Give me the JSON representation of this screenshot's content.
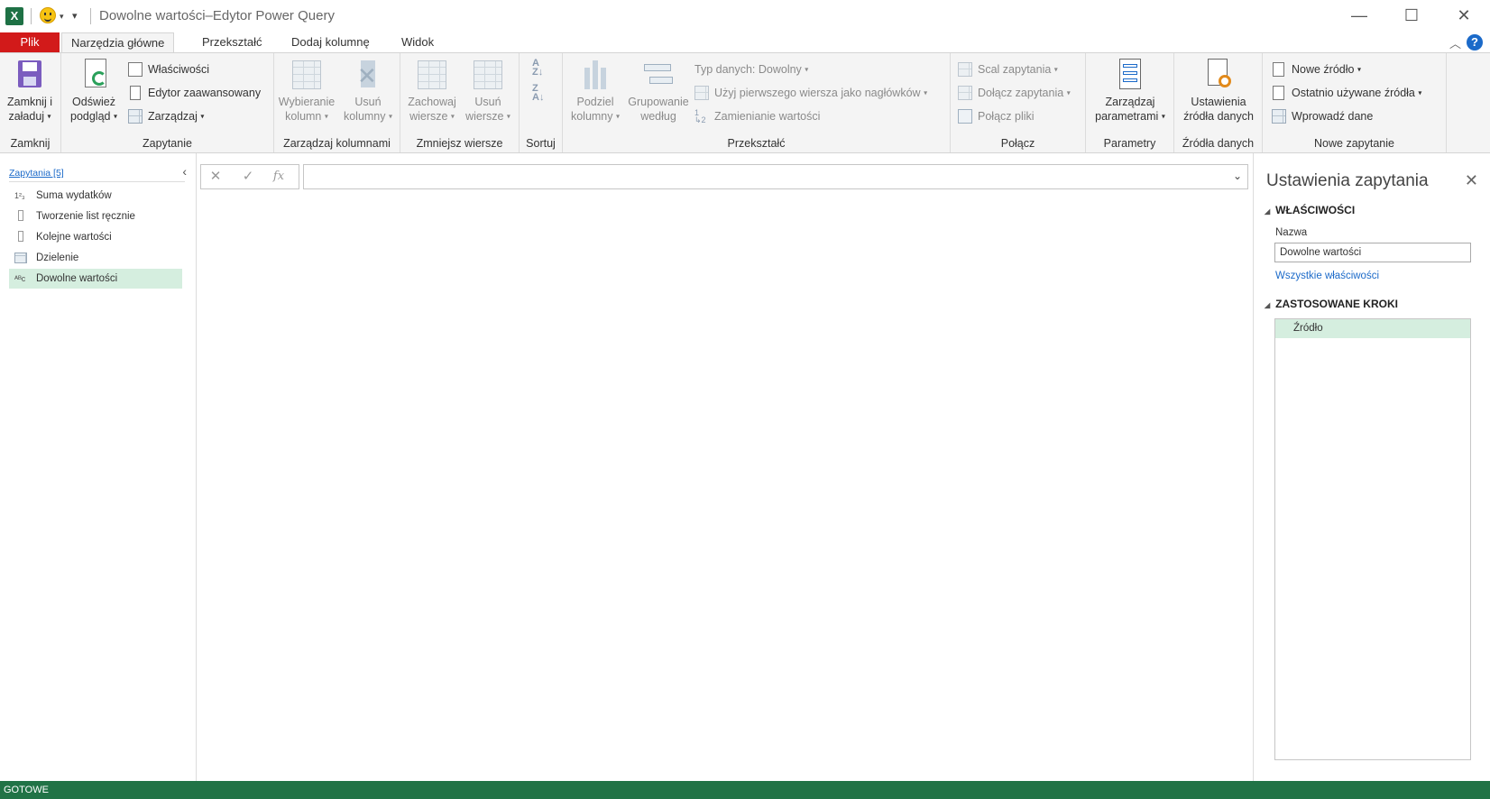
{
  "window": {
    "title": "Dowolne wartości–Edytor Power Query",
    "app_logo": "X"
  },
  "tabs": {
    "file": "Plik",
    "home": "Narzędzia główne",
    "transform": "Przekształć",
    "add_column": "Dodaj kolumnę",
    "view": "Widok",
    "help": "?"
  },
  "ribbon": {
    "close": {
      "group": "Zamknij",
      "btn_line1": "Zamknij i",
      "btn_line2": "załaduj"
    },
    "query": {
      "group": "Zapytanie",
      "refresh_line1": "Odśwież",
      "refresh_line2": "podgląd",
      "properties": "Właściwości",
      "advanced_editor": "Edytor zaawansowany",
      "manage": "Zarządzaj"
    },
    "manage_columns": {
      "group": "Zarządzaj kolumnami",
      "choose_line1": "Wybieranie",
      "choose_line2": "kolumn",
      "remove_line1": "Usuń",
      "remove_line2": "kolumny"
    },
    "reduce_rows": {
      "group": "Zmniejsz wiersze",
      "keep_line1": "Zachowaj",
      "keep_line2": "wiersze",
      "remove_line1": "Usuń",
      "remove_line2": "wiersze"
    },
    "sort": {
      "group": "Sortuj"
    },
    "transform": {
      "group": "Przekształć",
      "split_line1": "Podziel",
      "split_line2": "kolumny",
      "group_line1": "Grupowanie",
      "group_line2": "według",
      "data_type": "Typ danych: Dowolny",
      "first_row_headers": "Użyj pierwszego wiersza jako nagłówków",
      "replace_values": "Zamienianie wartości"
    },
    "combine": {
      "group": "Połącz",
      "merge": "Scal zapytania",
      "append": "Dołącz zapytania",
      "combine_files": "Połącz pliki"
    },
    "parameters": {
      "group": "Parametry",
      "manage_line1": "Zarządzaj",
      "manage_line2": "parametrami"
    },
    "data_sources": {
      "group": "Źródła danych",
      "settings_line1": "Ustawienia",
      "settings_line2": "źródła danych"
    },
    "new_query": {
      "group": "Nowe zapytanie",
      "new_source": "Nowe źródło",
      "recent_sources": "Ostatnio używane źródła",
      "enter_data": "Wprowadź dane"
    }
  },
  "queries": {
    "header": "Zapytania [5]",
    "items": [
      {
        "label": "Suma wydatków",
        "icon": "123"
      },
      {
        "label": "Tworzenie list ręcznie",
        "icon": "list"
      },
      {
        "label": "Kolejne wartości",
        "icon": "list"
      },
      {
        "label": "Dzielenie",
        "icon": "table"
      },
      {
        "label": "Dowolne wartości",
        "icon": "ABC"
      }
    ],
    "selected_index": 4
  },
  "formula_bar": {
    "fx": "fx",
    "value": ""
  },
  "settings": {
    "title": "Ustawienia zapytania",
    "properties_heading": "WŁAŚCIWOŚCI",
    "name_label": "Nazwa",
    "name_value": "Dowolne wartości",
    "all_properties_link": "Wszystkie właściwości",
    "steps_heading": "ZASTOSOWANE KROKI",
    "steps": [
      "Źródło"
    ]
  },
  "status": {
    "text": "GOTOWE"
  },
  "colors": {
    "excel_green": "#217346",
    "file_tab_red": "#d21a1a",
    "selection": "#d5eedf",
    "link_blue": "#1b6ac9"
  }
}
